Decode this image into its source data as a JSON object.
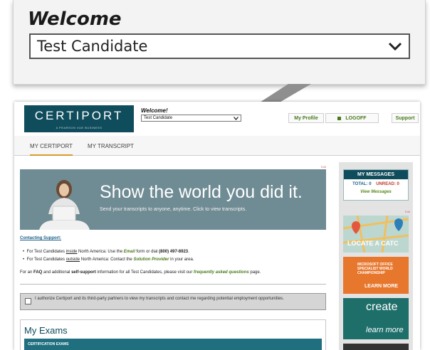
{
  "zoom": {
    "welcome": "Welcome",
    "selected_name": "Test Candidate"
  },
  "header": {
    "logo": "CERTIPORT",
    "logo_sub": "A PEARSON VUE BUSINESS",
    "welcome": "Welcome!",
    "selected_name": "Test Candidate",
    "my_profile": "My Profile",
    "logoff": "LOGOFF",
    "support": "Support"
  },
  "tabs": [
    {
      "label": "MY CERTIPORT",
      "active": true
    },
    {
      "label": "MY TRANSCRIPT",
      "active": false
    }
  ],
  "edit_label": "Edit",
  "banner": {
    "title": "Show the world you did it.",
    "subtitle": "Send your transcripts to anyone, anytime. Click to view transcripts."
  },
  "support_section": {
    "heading": "Contacting Support:",
    "bullet1": {
      "a": "For Test Candidates ",
      "b": "inside",
      "c": " North America: Use the ",
      "d": "Email",
      "e": " form or dial ",
      "f": "(800) 497-8923",
      "g": "."
    },
    "bullet2": {
      "a": "For Test Candidates ",
      "b": "outside",
      "c": " North America: Contact the ",
      "d": "Solution Provider",
      "e": " in your area."
    },
    "para": {
      "a": "For an ",
      "b": "FAQ",
      "c": " and additional ",
      "d": "self-support",
      "e": " information for all Test Candidates, please visit our ",
      "f": "frequently asked questions",
      "g": " page."
    }
  },
  "authorization": "I authorize Certiport and its third-party partners to view my transcripts and contact me regarding potential employment opportunities.",
  "exams": {
    "title": "My Exams",
    "section": "CERTIFICATION EXAMS"
  },
  "sidebar": {
    "messages_title": "MY MESSAGES",
    "total_label": "TOTAL: 0",
    "unread_label": "UNREAD: 0",
    "view_messages": "View Messages",
    "ad_locate": "LOCATE A CATC",
    "ad_mos": "MICROSOFT OFFICE SPECIALIST WORLD CHAMPIONSHIP",
    "ad_mos_more": "LEARN MORE",
    "ad_create": "create",
    "ad_create_more": "learn more"
  },
  "colors": {
    "teal": "#0f4c5c",
    "banner": "#6f8b94",
    "green": "#4a7a1c",
    "link": "#1c5f8a",
    "tab_underline": "#d99a2b"
  }
}
